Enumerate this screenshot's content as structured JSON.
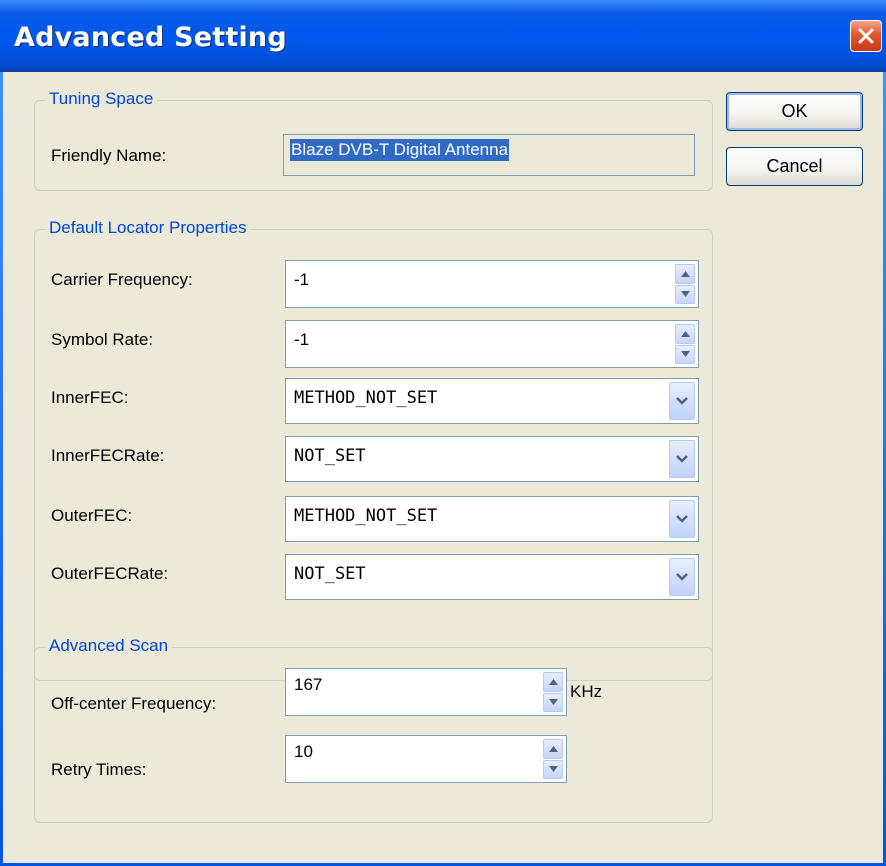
{
  "window": {
    "title": "Advanced Setting"
  },
  "buttons": {
    "ok": "OK",
    "cancel": "Cancel"
  },
  "tuning_space": {
    "title": "Tuning Space",
    "friendly_name_label": "Friendly Name:",
    "friendly_name_value": "Blaze DVB-T Digital Antenna"
  },
  "default_locator": {
    "title": "Default Locator Properties",
    "carrier_frequency": {
      "label": "Carrier Frequency:",
      "value": "-1"
    },
    "symbol_rate": {
      "label": "Symbol Rate:",
      "value": "-1"
    },
    "inner_fec": {
      "label": "InnerFEC:",
      "value": "METHOD_NOT_SET"
    },
    "inner_fec_rate": {
      "label": "InnerFECRate:",
      "value": "NOT_SET"
    },
    "outer_fec": {
      "label": "OuterFEC:",
      "value": "METHOD_NOT_SET"
    },
    "outer_fec_rate": {
      "label": "OuterFECRate:",
      "value": "NOT_SET"
    }
  },
  "advanced_scan": {
    "title": "Advanced Scan",
    "off_center_frequency": {
      "label": "Off-center Frequency:",
      "value": "167",
      "unit": "KHz"
    },
    "retry_times": {
      "label": "Retry Times:",
      "value": "10"
    }
  },
  "colors": {
    "title_bar": "#0058ee",
    "dialog_bg": "#ece9d8",
    "group_title": "#0046d5",
    "selection": "#316ac5"
  }
}
